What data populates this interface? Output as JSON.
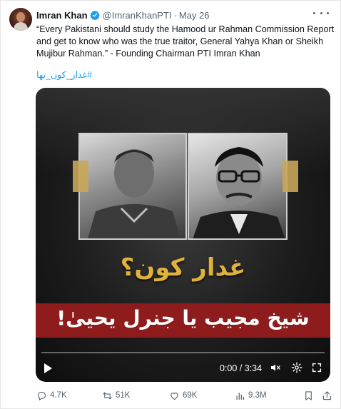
{
  "author": {
    "name": "Imran Khan",
    "handle": "@ImranKhanPTI",
    "separator": "·",
    "date": "May 26"
  },
  "tweet": {
    "text": "“Every Pakistani should study the Hamood ur Rahman Commission Report and get to know who was the true traitor, General Yahya Khan or Sheikh Mujibur Rahman.” - Founding Chairman PTI Imran Khan",
    "hashtag": "#غدار_کون_تھا"
  },
  "video": {
    "headline_top": "غدار کون؟",
    "headline_bottom": "شیخ مجیب یا جنرل یحییٰ!",
    "time": "0:00 / 3:34",
    "progress_fraction": 0.0
  },
  "actions": {
    "replies": "4.7K",
    "reposts": "51K",
    "likes": "69K",
    "views": "9.3M"
  },
  "colors": {
    "link": "#1d9bf0",
    "verified": "#1d9bf0",
    "muted": "#536471",
    "banner": "#8f1c1c",
    "headline": "#e0b23a"
  }
}
